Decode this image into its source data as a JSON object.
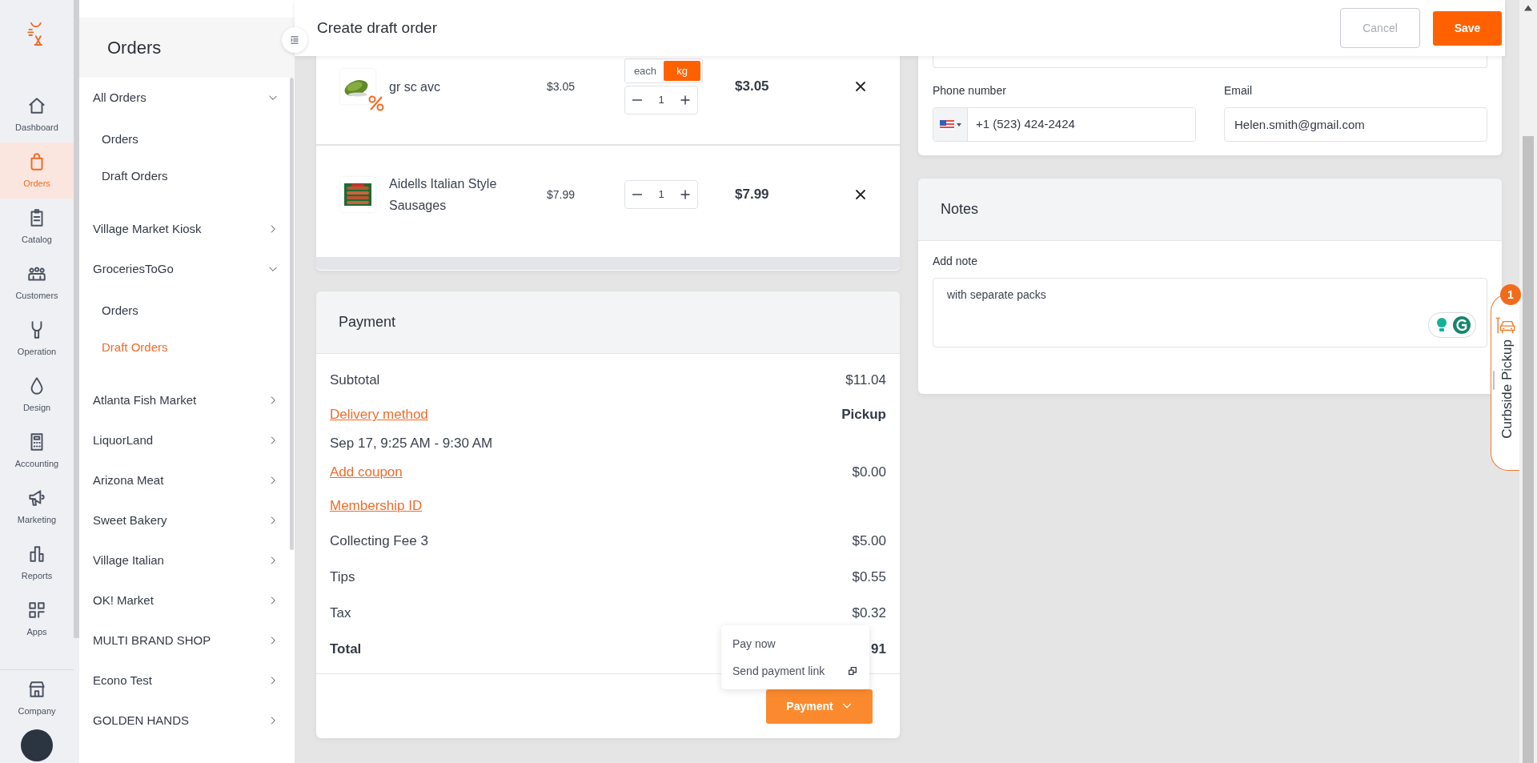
{
  "rail": {
    "items": [
      {
        "label": "Dashboard",
        "selected": false
      },
      {
        "label": "Orders",
        "selected": true
      },
      {
        "label": "Catalog",
        "selected": false
      },
      {
        "label": "Customers",
        "selected": false
      },
      {
        "label": "Operation",
        "selected": false
      },
      {
        "label": "Design",
        "selected": false
      },
      {
        "label": "Accounting",
        "selected": false
      },
      {
        "label": "Marketing",
        "selected": false
      },
      {
        "label": "Reports",
        "selected": false
      },
      {
        "label": "Apps",
        "selected": false
      }
    ],
    "bottom_items": [
      {
        "label": "Company",
        "selected": false
      }
    ]
  },
  "sidebar": {
    "title": "Orders",
    "items": [
      {
        "label": "All Orders",
        "expanded": true,
        "children": [
          {
            "label": "Orders",
            "selected": false
          },
          {
            "label": "Draft Orders",
            "selected": false
          }
        ]
      },
      {
        "label": "Village Market Kiosk",
        "expanded": false
      },
      {
        "label": "GroceriesToGo",
        "expanded": true,
        "children": [
          {
            "label": "Orders",
            "selected": false
          },
          {
            "label": "Draft Orders",
            "selected": true
          }
        ]
      },
      {
        "label": "Atlanta Fish Market",
        "expanded": false
      },
      {
        "label": "LiquorLand",
        "expanded": false
      },
      {
        "label": "Arizona Meat",
        "expanded": false
      },
      {
        "label": "Sweet Bakery",
        "expanded": false
      },
      {
        "label": "Village Italian",
        "expanded": false
      },
      {
        "label": "OK! Market",
        "expanded": false
      },
      {
        "label": "MULTI BRAND SHOP",
        "expanded": false
      },
      {
        "label": "Econo Test",
        "expanded": false
      },
      {
        "label": "GOLDEN HANDS",
        "expanded": false
      }
    ]
  },
  "header": {
    "title": "Create draft order",
    "buttons": [
      {
        "label": "Cancel",
        "kind": "outline",
        "disabled": true
      },
      {
        "label": "Save",
        "kind": "primary",
        "disabled": false
      }
    ]
  },
  "products": [
    {
      "name": "gr sc avc",
      "price": "$3.05",
      "discount": true,
      "units": [
        {
          "label": "each",
          "selected": false
        },
        {
          "label": "kg",
          "selected": true
        }
      ],
      "quantity": "1",
      "total": "$3.05"
    },
    {
      "name": "Aidells Italian Style Sausages",
      "price": "$7.99",
      "discount": false,
      "quantity": "1",
      "total": "$7.99"
    }
  ],
  "payment": {
    "title": "Payment",
    "rows": [
      {
        "kind": "text",
        "label": "Subtotal",
        "value": "$11.04",
        "value_bold": false
      },
      {
        "kind": "link",
        "label": "Delivery method",
        "value": "Pickup",
        "value_bold": true
      },
      {
        "kind": "note",
        "label": "Sep 17, 9:25 AM - 9:30 AM"
      },
      {
        "kind": "link",
        "label": "Add coupon",
        "value": "$0.00",
        "value_bold": false
      },
      {
        "kind": "link",
        "label": "Membership ID"
      },
      {
        "kind": "text",
        "label": "Collecting Fee 3",
        "value": "$5.00",
        "value_bold": false
      },
      {
        "kind": "text",
        "label": "Tips",
        "value": "$0.55",
        "value_bold": false
      },
      {
        "kind": "text",
        "label": "Tax",
        "value": "$0.32",
        "value_bold": false
      },
      {
        "kind": "total",
        "label": "Total",
        "value": "91",
        "value_bold": true
      }
    ],
    "button": "Payment",
    "menu": [
      {
        "label": "Pay now",
        "external": false
      },
      {
        "label": "Send payment link",
        "external": true
      }
    ]
  },
  "contact": {
    "phone_label": "Phone number",
    "phone": "+1 (523) 424-2424",
    "email_label": "Email",
    "email": "Helen.smith@gmail.com"
  },
  "notes": {
    "title": "Notes",
    "label": "Add note",
    "text": "with separate packs"
  },
  "curbside": {
    "label": "Curbside Pickup",
    "count": "1"
  }
}
